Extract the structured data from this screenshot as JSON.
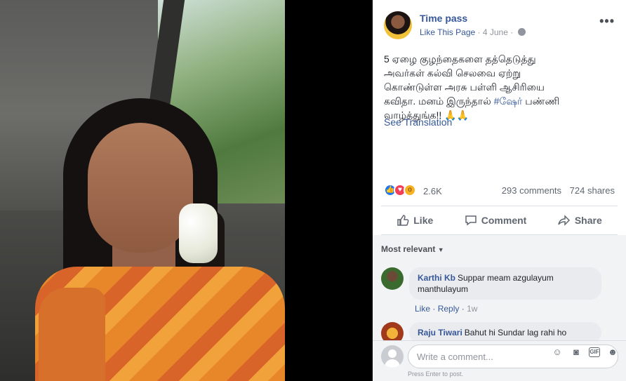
{
  "post": {
    "page_name": "Time pass",
    "like_page_label": "Like This Page",
    "date": "4 June",
    "text_lines": [
      "5 ஏழை குழந்தைகளை தத்தெடுத்து",
      "அவர்கள் கல்வி செலவை ஏற்று",
      "கொண்டுள்ள அரசு பள்ளி ஆசிரியை",
      "கவிதா. மனம் இருந்தால் ",
      "வாழ்த்துங்க!! 🙏🙏"
    ],
    "hashtag": "#ஷேர்",
    "hashtag_suffix": " பண்ணி",
    "see_translation": "See Translation",
    "more_icon": "more-options-icon"
  },
  "stats": {
    "reactions_count": "2.6K",
    "comments": "293 comments",
    "shares": "724 shares",
    "reaction_icons": [
      "like-reaction-icon",
      "love-reaction-icon",
      "wow-reaction-icon"
    ]
  },
  "actions": {
    "like": "Like",
    "comment": "Comment",
    "share": "Share"
  },
  "comments": {
    "sort_label": "Most relevant",
    "items": [
      {
        "author": "Karthi Kb",
        "text": "Suppar meam azgulayum manthulayum",
        "like": "Like",
        "reply": "Reply",
        "time": "1w"
      },
      {
        "author": "Raju Tiwari",
        "text": "Bahut hi Sundar lag rahi ho"
      }
    ],
    "input_placeholder": "Write a comment...",
    "press_enter": "Press Enter to post."
  },
  "colors": {
    "link": "#365899",
    "text": "#1d2129",
    "muted": "#90949c",
    "like_blue": "#2078f4",
    "love_red": "#f33e58",
    "wow_yellow": "#f7b125"
  }
}
